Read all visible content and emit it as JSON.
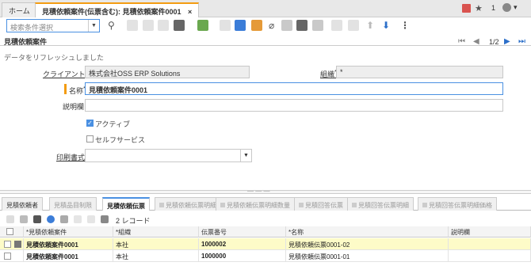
{
  "tabs": [
    {
      "label": "ホーム"
    },
    {
      "label": "見積依頼案件(伝票含む): 見積依頼案件0001",
      "close": "×"
    }
  ],
  "top_right": {
    "count": "1",
    "user_caret": "▾"
  },
  "toolbar": {
    "search_placeholder": "検索条件選択",
    "more": "⋮"
  },
  "header": {
    "title": "見積依頼案件",
    "pager": "1/2",
    "status": "データをリフレッシュしました"
  },
  "form": {
    "client_label": "クライアント",
    "client_value": "株式会社OSS ERP Solutions",
    "org_label": "組織",
    "org_value": "*",
    "name_label": "名称",
    "name_value": "見積依頼案件0001",
    "desc_label": "説明欄",
    "desc_value": "",
    "active_label": "アクティブ",
    "active_checked": true,
    "selfservice_label": "セルフサービス",
    "selfservice_checked": false,
    "print_label": "印刷書式",
    "print_value": "",
    "req_mark": "*"
  },
  "splitter": "— — —",
  "detail_tabs": [
    {
      "label": "見積依頼者",
      "state": "enabled"
    },
    {
      "label": "見積品目制限",
      "state": "disabled"
    },
    {
      "label": "見積依頼伝票",
      "state": "active"
    },
    {
      "label": "見積依頼伝票明細",
      "state": "disabled"
    },
    {
      "label": "見積依頼伝票明細数量",
      "state": "disabled"
    },
    {
      "label": "見積回答伝票",
      "state": "disabled"
    },
    {
      "label": "見積回答伝票明細",
      "state": "disabled"
    },
    {
      "label": "見積回答伝票明細価格",
      "state": "disabled"
    }
  ],
  "grid": {
    "record_count": "2 レコード",
    "columns": [
      "",
      "*見積依頼案件",
      "*組織",
      "伝票番号",
      "*名称",
      "説明欄"
    ],
    "rows": [
      {
        "case": "見積依頼案件0001",
        "org": "本社",
        "doc_no": "1000002",
        "name": "見積依頼伝票0001-02",
        "desc": ""
      },
      {
        "case": "見積依頼案件0001",
        "org": "本社",
        "doc_no": "1000000",
        "name": "見積依頼伝票0001-01",
        "desc": ""
      }
    ]
  },
  "colors": {
    "accent": "#f39c12",
    "focus": "#4a90e2",
    "selected_row": "#fdfbc8"
  }
}
